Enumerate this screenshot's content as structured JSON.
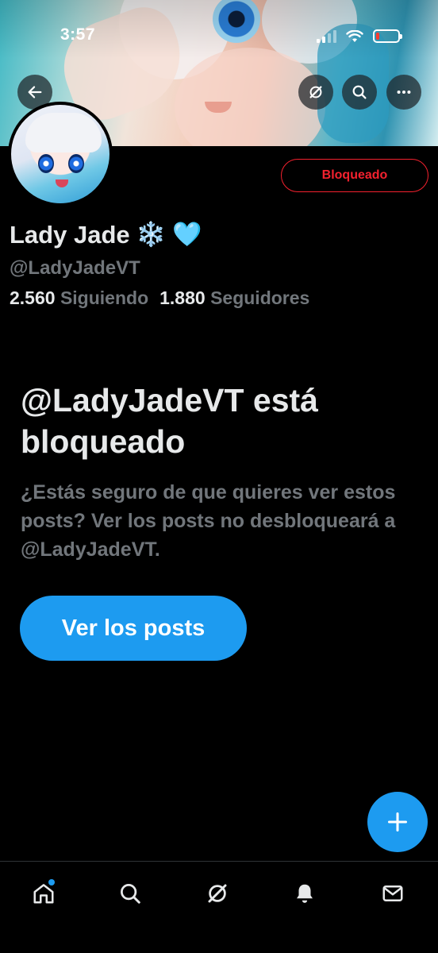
{
  "status_bar": {
    "time": "3:57",
    "battery_level": 0.15
  },
  "header": {
    "back_icon": "arrow-left-icon",
    "grok_icon": "grok-icon",
    "search_icon": "search-icon",
    "more_icon": "more-horizontal-icon"
  },
  "profile": {
    "display_name": "Lady Jade",
    "emoji_1": "❄️",
    "emoji_2": "🩵",
    "handle": "@LadyJadeVT",
    "following_count": "2.560",
    "following_label": "Siguiendo",
    "followers_count": "1.880",
    "followers_label": "Seguidores",
    "blocked_button_label": "Bloqueado"
  },
  "blocked_notice": {
    "title": "@LadyJadeVT está bloqueado",
    "description": "¿Estás seguro de que quieres ver estos posts? Ver los posts no desbloqueará a @LadyJadeVT.",
    "button_label": "Ver los posts"
  },
  "fab": {
    "icon": "plus-icon"
  },
  "bottom_nav": [
    {
      "name": "home",
      "icon": "home-icon",
      "active": true,
      "has_badge_dot": true
    },
    {
      "name": "search",
      "icon": "search-icon"
    },
    {
      "name": "grok",
      "icon": "grok-icon"
    },
    {
      "name": "notifications",
      "icon": "bell-icon"
    },
    {
      "name": "messages",
      "icon": "envelope-icon"
    }
  ],
  "colors": {
    "accent": "#1d9bf0",
    "blocked_red": "#f4212e",
    "secondary_text": "#71767b",
    "primary_text": "#e7e9ea",
    "background": "#000000"
  }
}
